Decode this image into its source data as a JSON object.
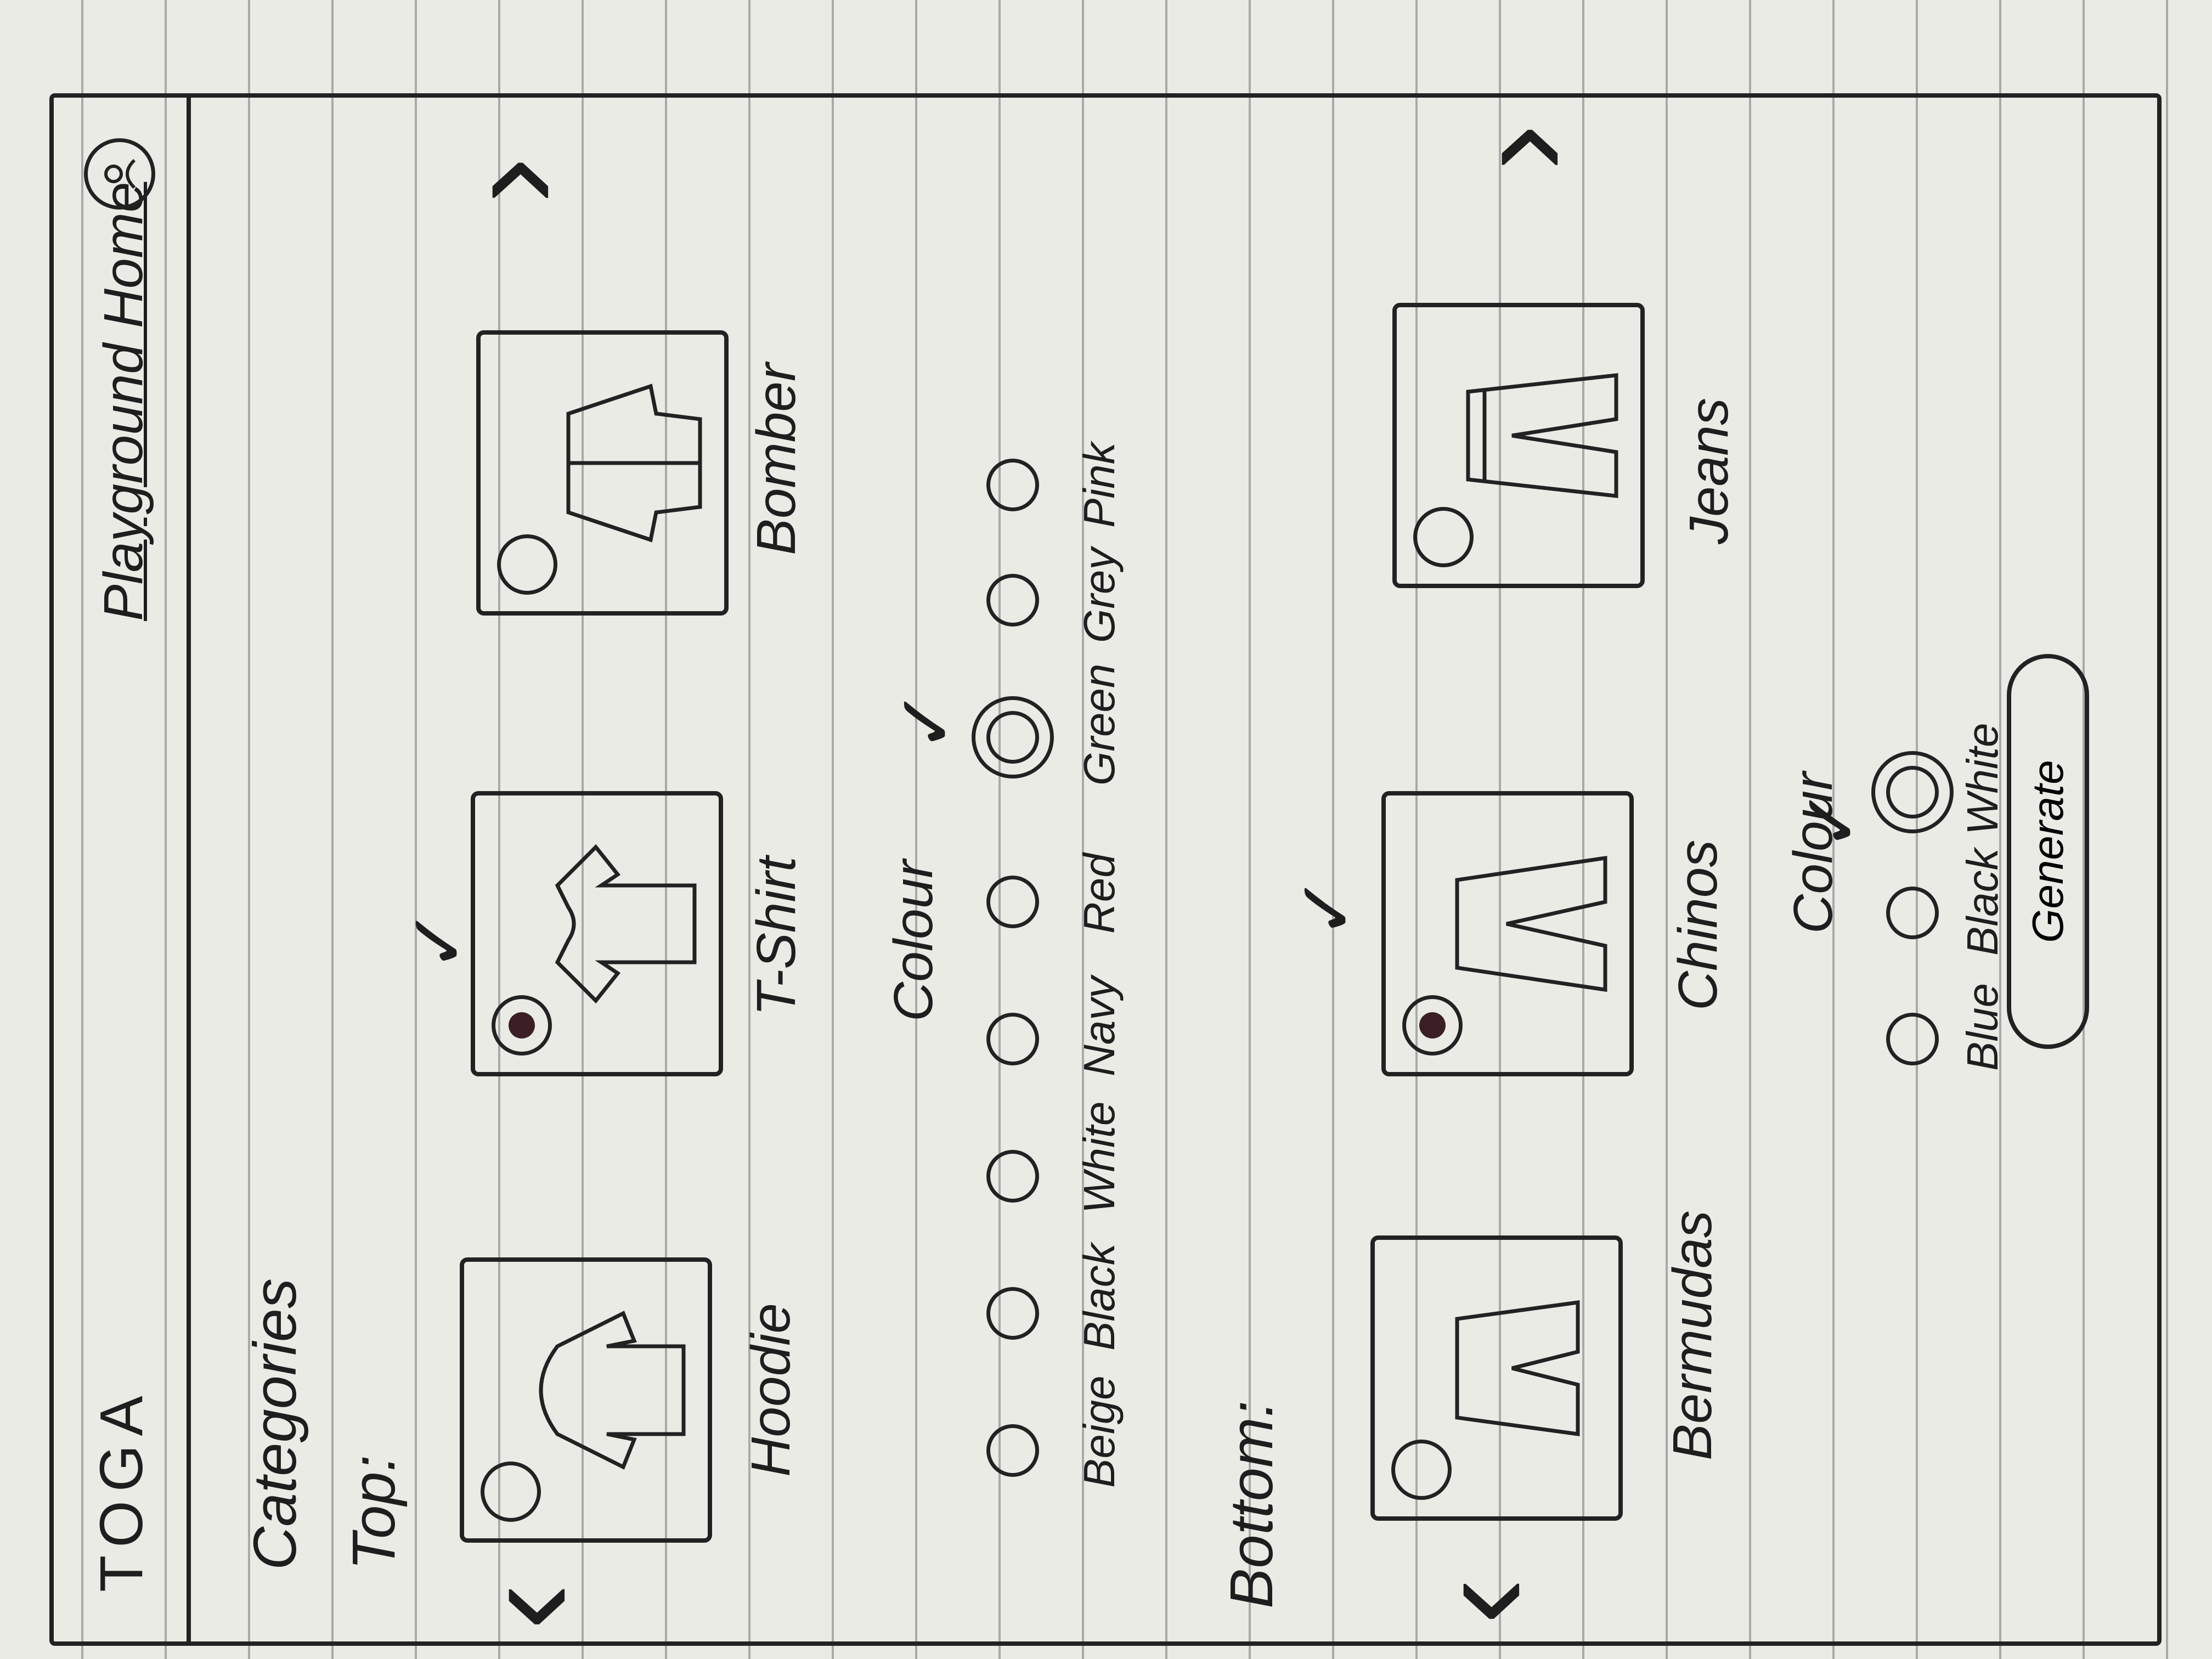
{
  "header": {
    "logo": "TOGA",
    "nav_link": "Playground Home"
  },
  "page": {
    "categories_label": "Categories"
  },
  "top": {
    "title": "Top:",
    "items": [
      {
        "label": "Hoodie",
        "selected": false
      },
      {
        "label": "T-Shirt",
        "selected": true
      },
      {
        "label": "Bomber",
        "selected": false
      }
    ],
    "colour_label": "Colour",
    "colours": [
      {
        "label": "Beige",
        "selected": false
      },
      {
        "label": "Black",
        "selected": false
      },
      {
        "label": "White",
        "selected": false
      },
      {
        "label": "Navy",
        "selected": false
      },
      {
        "label": "Red",
        "selected": false
      },
      {
        "label": "Green",
        "selected": true
      },
      {
        "label": "Grey",
        "selected": false
      },
      {
        "label": "Pink",
        "selected": false
      }
    ]
  },
  "bottom": {
    "title": "Bottom:",
    "items": [
      {
        "label": "Bermudas",
        "selected": false
      },
      {
        "label": "Chinos",
        "selected": true
      },
      {
        "label": "Jeans",
        "selected": false
      }
    ],
    "colour_label": "Colour",
    "colours": [
      {
        "label": "Blue",
        "selected": false
      },
      {
        "label": "Black",
        "selected": false
      },
      {
        "label": "White",
        "selected": true
      }
    ]
  },
  "actions": {
    "generate_label": "Generate"
  },
  "icons": {
    "prev": "chevron-left-icon",
    "next": "chevron-right-icon",
    "profile": "profile-icon"
  }
}
